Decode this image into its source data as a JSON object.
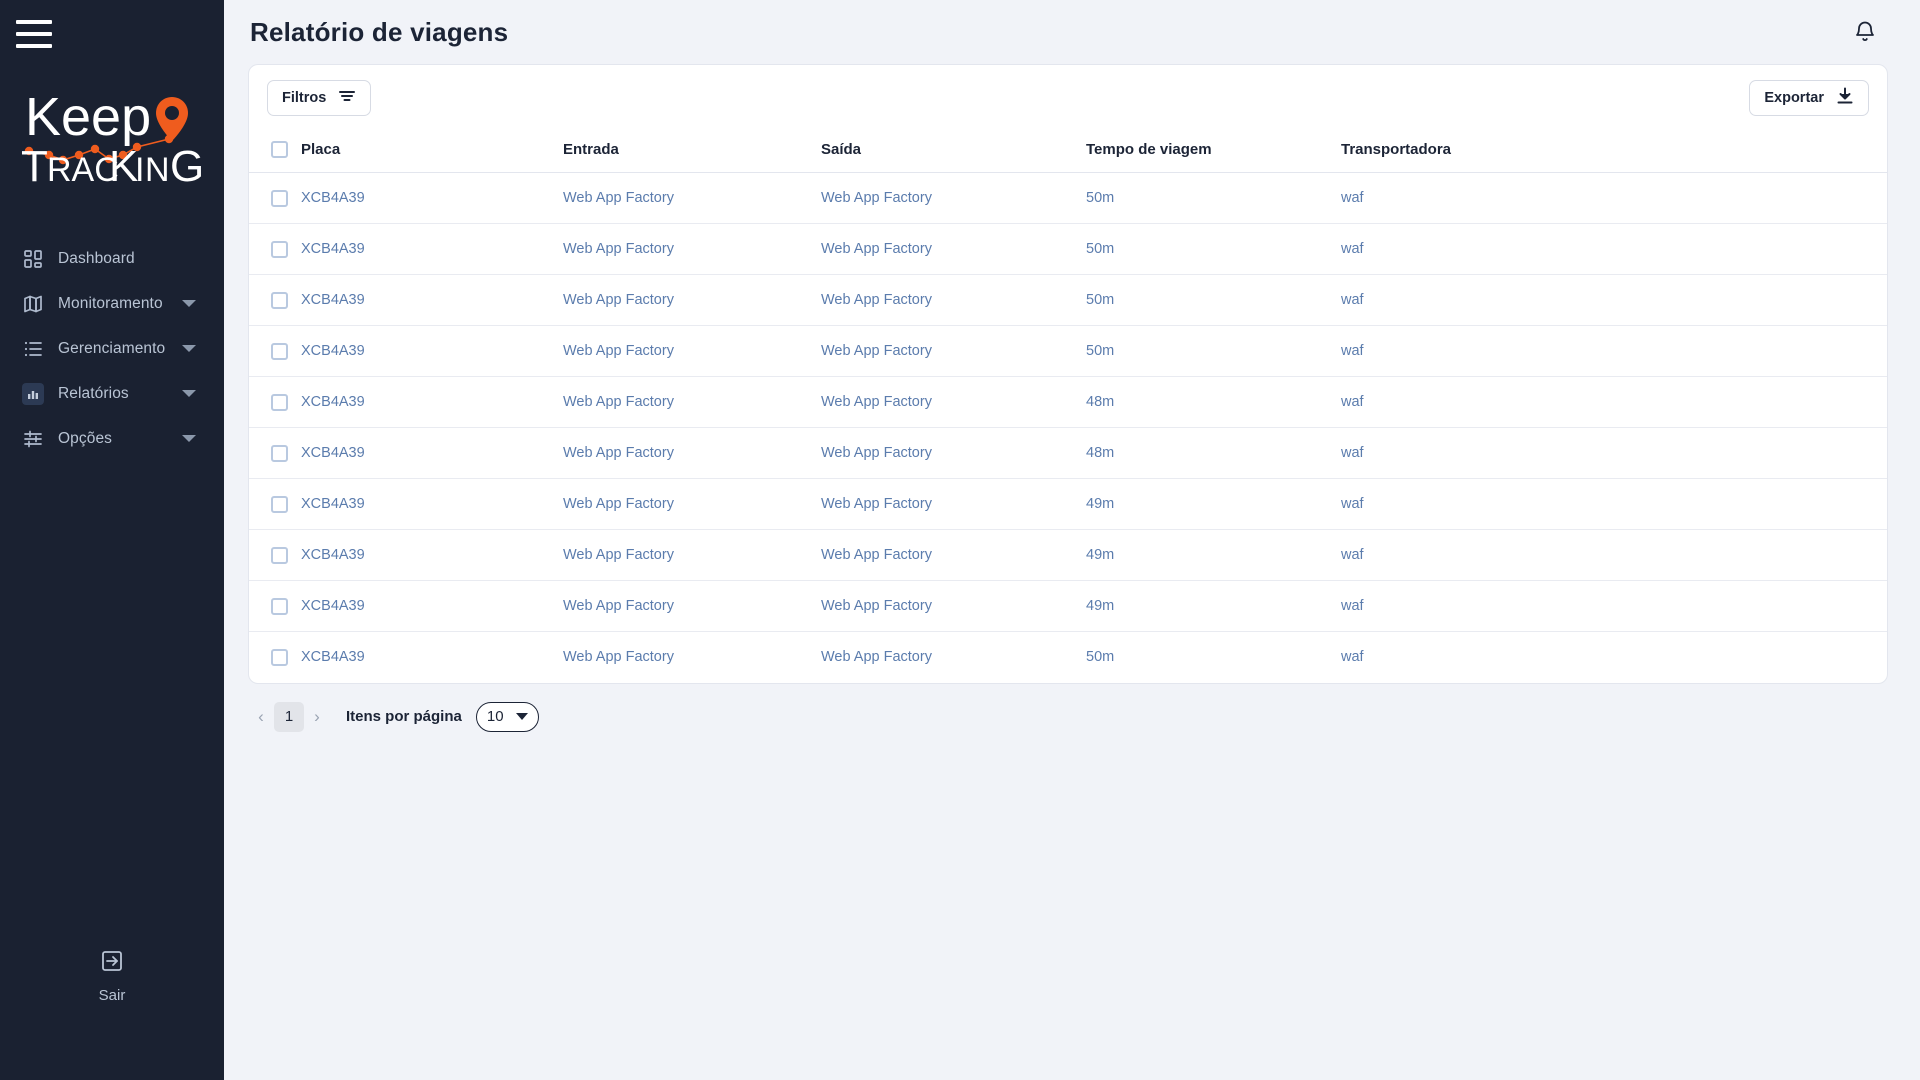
{
  "sidebar": {
    "menu_icon": "hamburger-icon",
    "logo": {
      "line1": "Keep",
      "line2": "TracKinG",
      "accent": "#ef5c1e"
    },
    "items": [
      {
        "label": "Dashboard",
        "icon": "grid-icon",
        "expandable": false,
        "active": false
      },
      {
        "label": "Monitoramento",
        "icon": "map-icon",
        "expandable": true,
        "active": false
      },
      {
        "label": "Gerenciamento",
        "icon": "list-icon",
        "expandable": true,
        "active": false
      },
      {
        "label": "Relatórios",
        "icon": "chart-icon",
        "expandable": true,
        "active": true
      },
      {
        "label": "Opções",
        "icon": "sliders-icon",
        "expandable": true,
        "active": false
      }
    ],
    "logout": {
      "label": "Sair",
      "icon": "logout-icon"
    }
  },
  "header": {
    "title": "Relatório de viagens",
    "notification_icon": "bell-icon"
  },
  "toolbar": {
    "filter_label": "Filtros",
    "filter_icon": "filter-icon",
    "export_label": "Exportar",
    "export_icon": "download-icon"
  },
  "table": {
    "columns": [
      "Placa",
      "Entrada",
      "Saída",
      "Tempo de viagem",
      "Transportadora"
    ],
    "rows": [
      {
        "placa": "XCB4A39",
        "entrada": "Web App Factory",
        "saida": "Web App Factory",
        "tempo": "50m",
        "transportadora": "waf"
      },
      {
        "placa": "XCB4A39",
        "entrada": "Web App Factory",
        "saida": "Web App Factory",
        "tempo": "50m",
        "transportadora": "waf"
      },
      {
        "placa": "XCB4A39",
        "entrada": "Web App Factory",
        "saida": "Web App Factory",
        "tempo": "50m",
        "transportadora": "waf"
      },
      {
        "placa": "XCB4A39",
        "entrada": "Web App Factory",
        "saida": "Web App Factory",
        "tempo": "50m",
        "transportadora": "waf"
      },
      {
        "placa": "XCB4A39",
        "entrada": "Web App Factory",
        "saida": "Web App Factory",
        "tempo": "48m",
        "transportadora": "waf"
      },
      {
        "placa": "XCB4A39",
        "entrada": "Web App Factory",
        "saida": "Web App Factory",
        "tempo": "48m",
        "transportadora": "waf"
      },
      {
        "placa": "XCB4A39",
        "entrada": "Web App Factory",
        "saida": "Web App Factory",
        "tempo": "49m",
        "transportadora": "waf"
      },
      {
        "placa": "XCB4A39",
        "entrada": "Web App Factory",
        "saida": "Web App Factory",
        "tempo": "49m",
        "transportadora": "waf"
      },
      {
        "placa": "XCB4A39",
        "entrada": "Web App Factory",
        "saida": "Web App Factory",
        "tempo": "49m",
        "transportadora": "waf"
      },
      {
        "placa": "XCB4A39",
        "entrada": "Web App Factory",
        "saida": "Web App Factory",
        "tempo": "50m",
        "transportadora": "waf"
      }
    ]
  },
  "pagination": {
    "prev_icon": "chevron-left-icon",
    "next_icon": "chevron-right-icon",
    "current_page": "1",
    "per_page_label": "Itens por página",
    "per_page_value": "10"
  },
  "colors": {
    "sidebar_bg": "#1a2131",
    "page_bg": "#f1f3f8",
    "accent": "#ef5c1e",
    "link_text": "#5b7cad",
    "heading": "#1c2436"
  }
}
